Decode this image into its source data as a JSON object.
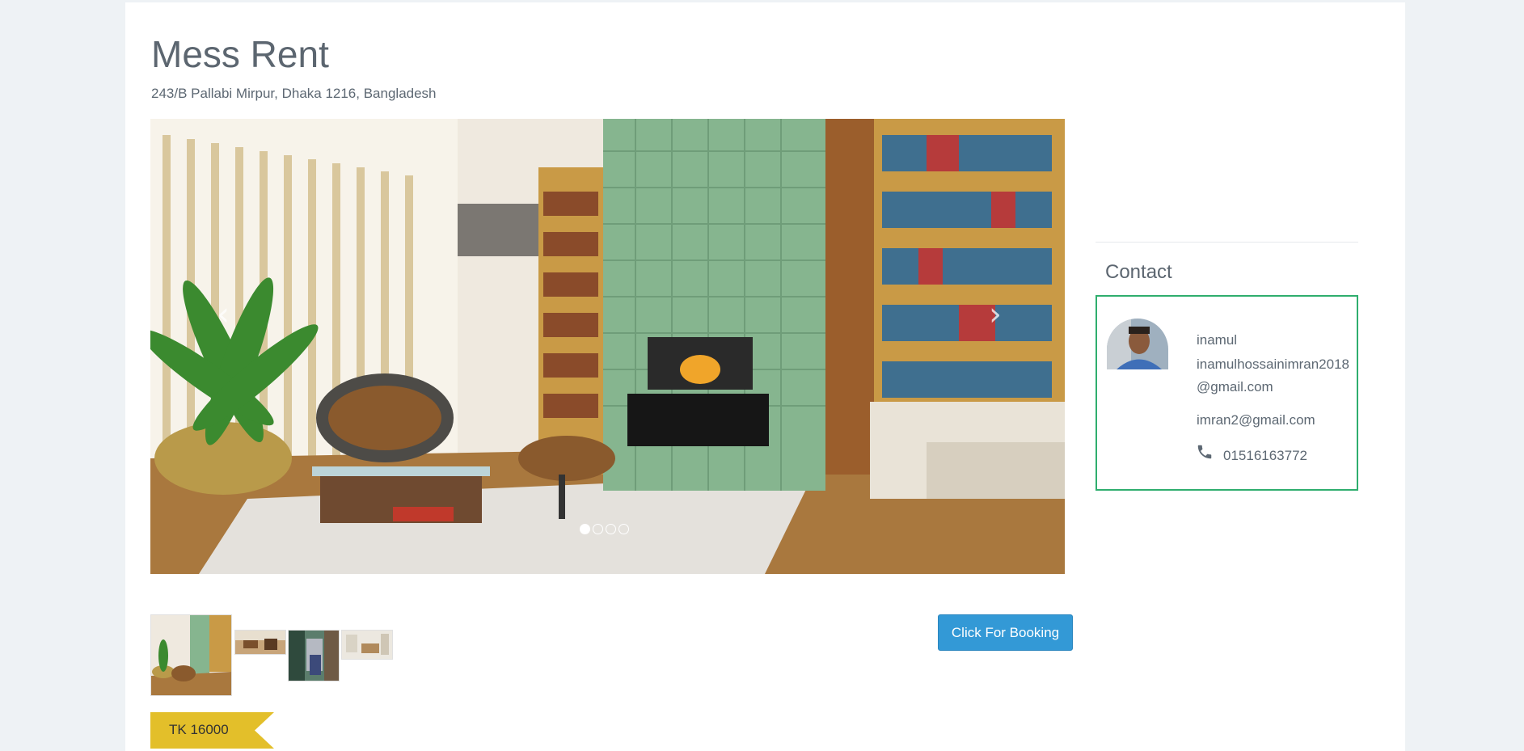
{
  "listing": {
    "title": "Mess Rent",
    "address": "243/B Pallabi Mirpur, Dhaka 1216, Bangladesh",
    "price": "TK 16000"
  },
  "carousel": {
    "slide_count": 4,
    "active_index": 0,
    "prev_icon": "chevron-left-icon",
    "next_icon": "chevron-right-icon"
  },
  "thumbnails": [
    {
      "name": "thumbnail-1",
      "selected": true
    },
    {
      "name": "thumbnail-2",
      "selected": false
    },
    {
      "name": "thumbnail-3",
      "selected": false
    },
    {
      "name": "thumbnail-4",
      "selected": false
    }
  ],
  "booking": {
    "label": "Click For Booking"
  },
  "contact": {
    "heading": "Contact",
    "name": "inamul",
    "email_primary": "inamulhossainimran2018@gmail.com",
    "email_secondary": "imran2@gmail.com",
    "phone": "01516163772",
    "phone_icon": "phone-icon"
  },
  "colors": {
    "accent_blue": "#3399d6",
    "contact_border": "#2fae6e",
    "price_ribbon": "#e3bf2a",
    "background": "#eef2f5"
  }
}
